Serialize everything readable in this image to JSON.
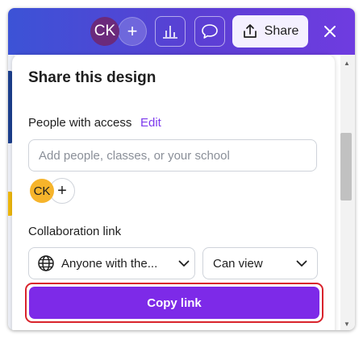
{
  "topbar": {
    "avatar_initials": "CK",
    "add_collaborator_symbol": "+",
    "share_label": "Share",
    "icons": [
      "add-icon",
      "insights-chart-icon",
      "comment-icon",
      "share-upload-icon",
      "close-icon"
    ],
    "gradient_colors": [
      "#3c53d6",
      "#6f3ce0"
    ]
  },
  "panel": {
    "title": "Share this design",
    "people_label": "People with access",
    "edit_label": "Edit",
    "people_input": {
      "placeholder": "Add people, classes, or your school",
      "value": ""
    },
    "member_initials": "CK",
    "member_add_symbol": "+",
    "collab_label": "Collaboration link",
    "access_dropdown": "Anyone with the...",
    "permission_dropdown": "Can view",
    "copy_link_label": "Copy link"
  },
  "colors": {
    "accent": "#7d2ae8",
    "edit_link": "#7c3aed",
    "highlight": "#d9232c",
    "member_avatar": "#f6b42b",
    "top_avatar": "#6b2a7c"
  }
}
